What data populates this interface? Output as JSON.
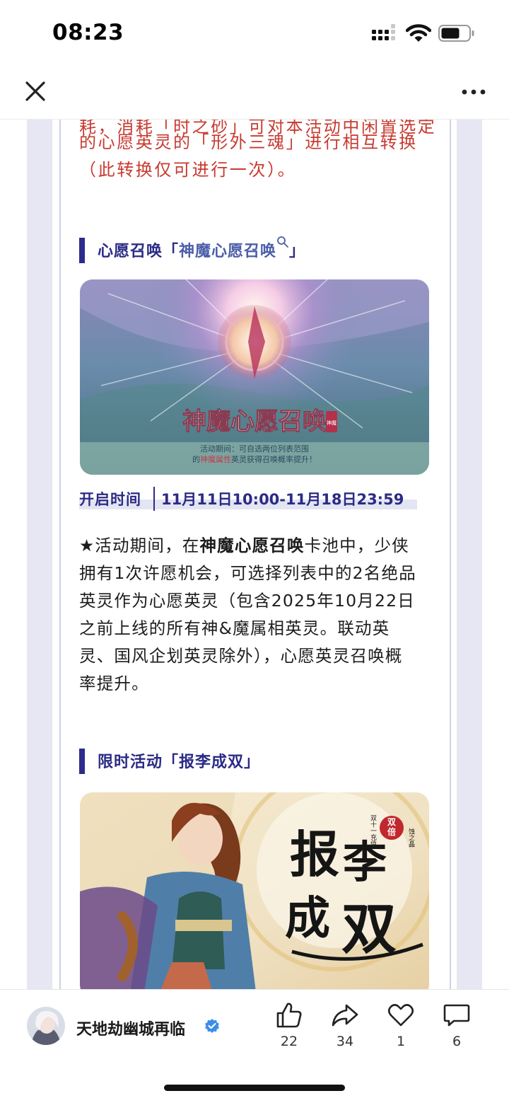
{
  "status_bar": {
    "time": "08:23"
  },
  "article": {
    "red_paragraph_lines": [
      "耗，消耗「时之砂」可对本活动中闲置选定",
      "的心愿英灵的「形外三魂」进行相互转换",
      "（此转换仅可进行一次）。"
    ],
    "section1": {
      "title_prefix": "心愿召唤「",
      "title_highlight": "神魔心愿召唤",
      "title_suffix": "」",
      "banner": {
        "title": "神魔心愿召唤",
        "seal": "神魔",
        "caption_line1": "活动期间：可自选两位列表范围",
        "caption_line2_a": "的",
        "caption_line2_hl": "神魔属性",
        "caption_line2_b": "英灵获得召唤概率提升！"
      },
      "time_label": "开启时间",
      "time_value": "11月11日10:00-11月18日23:59",
      "body": {
        "line1_a": "★活动期间，在",
        "line1_bold": "神魔心愿召唤",
        "line1_b": "卡池中，少侠",
        "line2": "拥有1次许愿机会，可选择列表中的2名绝品",
        "line3": "英灵作为心愿英灵（包含2025年10月22日",
        "line4": "之前上线的所有神&魔属相英灵。联动英",
        "line5": "灵、国风企划英灵除外），心愿英灵召唤概",
        "line6": "率提升。"
      }
    },
    "section2": {
      "title": "限时活动「报李成双」",
      "banner": {
        "title_chars": [
          "报",
          "李",
          "成",
          "双"
        ],
        "badge_top": "双",
        "badge_bottom": "倍",
        "side_left": "双十一充值",
        "side_right": "蚀之晶"
      }
    }
  },
  "bottom_bar": {
    "author": "天地劫幽城再临",
    "like_count": "22",
    "share_count": "34",
    "favorite_count": "1",
    "comment_count": "6"
  },
  "colors": {
    "accent_navy": "#2b2b85",
    "red_text": "#c73a30",
    "verified_blue": "#3b8eea",
    "side_panel": "#e6e7f3"
  },
  "icons": [
    "close-icon",
    "more-icon",
    "search-icon",
    "like-icon",
    "share-icon",
    "heart-icon",
    "comment-icon",
    "verified-icon"
  ]
}
